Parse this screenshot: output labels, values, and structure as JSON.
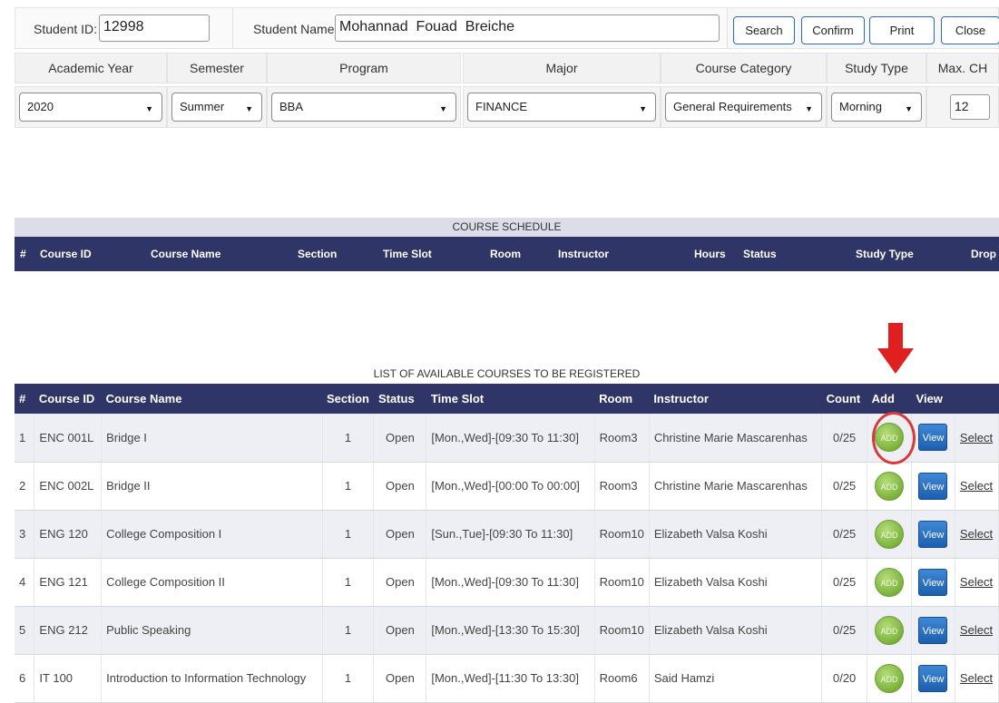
{
  "form": {
    "student_id_label": "Student ID:",
    "student_id_value": "12998",
    "student_name_label": "Student Name:",
    "student_name_value": "Mohannad  Fouad  Breiche",
    "buttons": {
      "search": "Search",
      "confirm": "Confirm",
      "print": "Print",
      "close": "Close"
    },
    "headers": {
      "academic_year": "Academic Year",
      "semester": "Semester",
      "program": "Program",
      "major": "Major",
      "course_category": "Course Category",
      "study_type": "Study Type",
      "max_ch": "Max. CH"
    },
    "selects": {
      "academic_year": "2020",
      "semester": "Summer",
      "program": "BBA",
      "major": "FINANCE",
      "course_category": "General Requirements",
      "study_type": "Morning"
    },
    "max_ch_value": "12"
  },
  "schedule": {
    "title": "COURSE SCHEDULE",
    "columns": {
      "num": "#",
      "course_id": "Course ID",
      "course_name": "Course Name",
      "section": "Section",
      "time_slot": "Time Slot",
      "room": "Room",
      "instructor": "Instructor",
      "hours": "Hours",
      "status": "Status",
      "study_type": "Study Type",
      "drop": "Drop"
    }
  },
  "available": {
    "title": "LIST OF AVAILABLE COURSES TO BE REGISTERED",
    "columns": {
      "num": "#",
      "course_id": "Course ID",
      "course_name": "Course Name",
      "section": "Section",
      "status": "Status",
      "time_slot": "Time Slot",
      "room": "Room",
      "instructor": "Instructor",
      "count": "Count",
      "add": "Add",
      "view": "View"
    },
    "add_label": "ADD",
    "view_label": "View",
    "select_label": "Select",
    "rows": [
      {
        "num": "1",
        "course_id": "ENC 001L",
        "course_name": "Bridge I",
        "section": "1",
        "status": "Open",
        "time_slot": "[Mon.,Wed]-[09:30 To 11:30]",
        "room": "Room3",
        "instructor": "Christine Marie Mascarenhas",
        "count": "0/25"
      },
      {
        "num": "2",
        "course_id": "ENC 002L",
        "course_name": "Bridge II",
        "section": "1",
        "status": "Open",
        "time_slot": "[Mon.,Wed]-[00:00 To 00:00]",
        "room": "Room3",
        "instructor": "Christine Marie Mascarenhas",
        "count": "0/25"
      },
      {
        "num": "3",
        "course_id": "ENG 120",
        "course_name": "College Composition I",
        "section": "1",
        "status": "Open",
        "time_slot": "[Sun.,Tue]-[09:30 To 11:30]",
        "room": "Room10",
        "instructor": "Elizabeth Valsa Koshi",
        "count": "0/25"
      },
      {
        "num": "4",
        "course_id": "ENG 121",
        "course_name": "College Composition II",
        "section": "1",
        "status": "Open",
        "time_slot": "[Mon.,Wed]-[09:30 To 11:30]",
        "room": "Room10",
        "instructor": "Elizabeth Valsa Koshi",
        "count": "0/25"
      },
      {
        "num": "5",
        "course_id": "ENG 212",
        "course_name": "Public Speaking",
        "section": "1",
        "status": "Open",
        "time_slot": "[Mon.,Wed]-[13:30 To 15:30]",
        "room": "Room10",
        "instructor": "Elizabeth Valsa Koshi",
        "count": "0/25"
      },
      {
        "num": "6",
        "course_id": "IT 100",
        "course_name": "Introduction to Information Technology",
        "section": "1",
        "status": "Open",
        "time_slot": "[Mon.,Wed]-[11:30 To 13:30]",
        "room": "Room6",
        "instructor": "Said Hamzi",
        "count": "0/20"
      }
    ]
  },
  "colors": {
    "header_navy": "#2f3566",
    "row_stripe": "#eeeff5",
    "add_green": "#7bb23c",
    "view_blue": "#1d5fae",
    "annotation_red": "#d83a3a"
  }
}
